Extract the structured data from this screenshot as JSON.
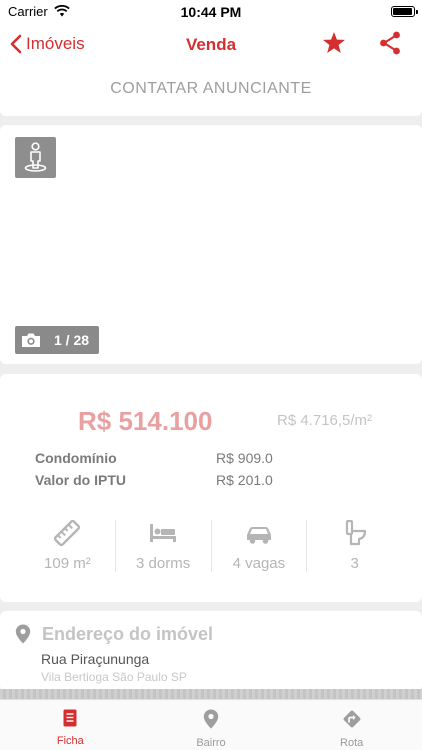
{
  "status_bar": {
    "carrier": "Carrier",
    "time": "10:44 PM"
  },
  "nav": {
    "back_label": "Imóveis",
    "title": "Venda",
    "accent_color": "#d32f2f"
  },
  "contact": {
    "label": "CONTATAR ANUNCIANTE"
  },
  "gallery": {
    "counter": "1 / 28",
    "current_photo": 1,
    "total_photos": 28
  },
  "pricing": {
    "price": "R$ 514.100",
    "price_per_m2": "R$ 4.716,5/m²",
    "condominium_label": "Condomínio",
    "condominium_value": "R$ 909.0",
    "iptu_label": "Valor do IPTU",
    "iptu_value": "R$ 201.0"
  },
  "features": [
    {
      "icon": "ruler-icon",
      "label": "109 m²"
    },
    {
      "icon": "bed-icon",
      "label": "3 dorms"
    },
    {
      "icon": "car-icon",
      "label": "4 vagas"
    },
    {
      "icon": "toilet-icon",
      "label": "3"
    }
  ],
  "address": {
    "title": "Endereço do imóvel",
    "street": "Rua Piraçununga",
    "neighborhood": "Vila Bertioga São Paulo SP"
  },
  "tabs": [
    {
      "label": "Ficha",
      "icon": "document-icon",
      "active": true
    },
    {
      "label": "Bairro",
      "icon": "location-pin-icon",
      "active": false
    },
    {
      "label": "Rota",
      "icon": "route-icon",
      "active": false
    }
  ]
}
